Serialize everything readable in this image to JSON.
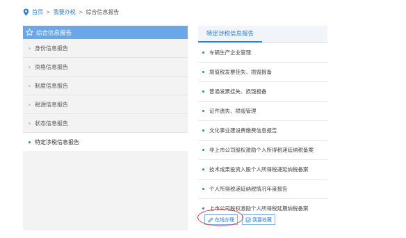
{
  "breadcrumb": {
    "items": [
      "首页",
      "我要办税",
      "综合信息报告"
    ],
    "separator": ">"
  },
  "sidebar": {
    "title": "综合信息报告",
    "items": [
      {
        "label": "身份信息报告",
        "active": false
      },
      {
        "label": "资格信息报告",
        "active": false
      },
      {
        "label": "制度信息报告",
        "active": false
      },
      {
        "label": "税源信息报告",
        "active": false
      },
      {
        "label": "状态信息报告",
        "active": false
      },
      {
        "label": "特定涉税信息报告",
        "active": true
      }
    ]
  },
  "panel": {
    "title": "特定涉税信息报告",
    "items": [
      "车辆生产企业管理",
      "增值税发票挂失、损毁报备",
      "普通发票挂失、损毁报备",
      "证件遗失、损毁管理",
      "文化事业建设费缴费信息报告",
      "非上市公司股权激励个人所得税递延纳税备案",
      "技术成果投资入股个人所得税递延纳税备案",
      "个人所得税递延纳税情况年度报告",
      "上市公司股权激励个人所得税延期纳税备案"
    ]
  },
  "actions": {
    "online_label": "在线办理",
    "favorite_label": "我要收藏"
  },
  "colors": {
    "accent": "#2a7fd6",
    "sidebar_header": "#6aa7e8",
    "highlight": "#e04040"
  }
}
